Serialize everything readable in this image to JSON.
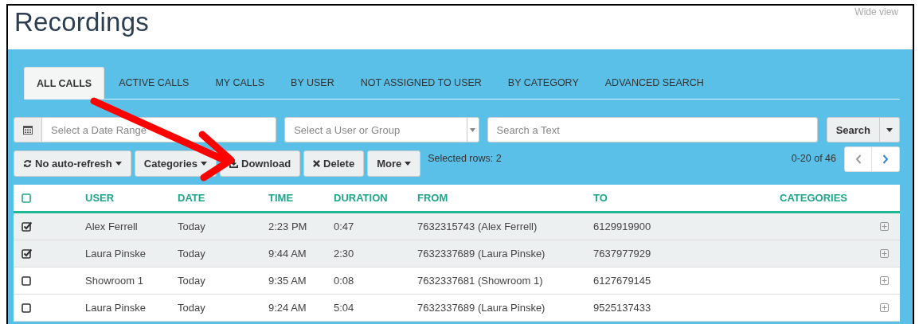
{
  "page": {
    "title": "Recordings",
    "wide_view": "Wide view"
  },
  "tabs": [
    {
      "label": "ALL CALLS",
      "selected": true
    },
    {
      "label": "ACTIVE CALLS",
      "selected": false
    },
    {
      "label": "MY CALLS",
      "selected": false
    },
    {
      "label": "BY USER",
      "selected": false
    },
    {
      "label": "NOT ASSIGNED TO USER",
      "selected": false
    },
    {
      "label": "BY CATEGORY",
      "selected": false
    },
    {
      "label": "ADVANCED SEARCH",
      "selected": false
    }
  ],
  "filters": {
    "date_range": {
      "placeholder": "Select a Date Range"
    },
    "user_group": {
      "placeholder": "Select a User or Group"
    },
    "text_search": {
      "placeholder": "Search a Text"
    },
    "search_button": "Search"
  },
  "toolbar": {
    "buttons": [
      {
        "kind": "refresh",
        "label": "No auto-refresh"
      },
      {
        "kind": "dropdown",
        "label": "Categories"
      },
      {
        "kind": "download",
        "label": "Download"
      },
      {
        "kind": "delete",
        "label": "Delete"
      },
      {
        "kind": "dropdown",
        "label": "More"
      }
    ],
    "selected_rows": "Selected rows: 2",
    "pagination": "0-20 of 46"
  },
  "table": {
    "select_all_checked": false,
    "columns": [
      "USER",
      "DATE",
      "TIME",
      "DURATION",
      "FROM",
      "TO",
      "CATEGORIES"
    ],
    "rows": [
      {
        "selected": true,
        "cells": [
          "Alex Ferrell",
          "Today",
          "2:23 PM",
          "0:47",
          "7632315743 (Alex Ferrell)",
          "6129919900"
        ]
      },
      {
        "selected": true,
        "cells": [
          "Laura Pinske",
          "Today",
          "9:44 AM",
          "2:30",
          "7632337689 (Laura Pinske)",
          "7637977929"
        ]
      },
      {
        "selected": false,
        "cells": [
          "Showroom 1",
          "Today",
          "9:35 AM",
          "0:08",
          "7632337681 (Showroom 1)",
          "6127679145"
        ]
      },
      {
        "selected": false,
        "cells": [
          "Laura Pinske",
          "Today",
          "9:24 AM",
          "5:04",
          "7632337689 (Laura Pinske)",
          "9525137433"
        ]
      }
    ]
  }
}
